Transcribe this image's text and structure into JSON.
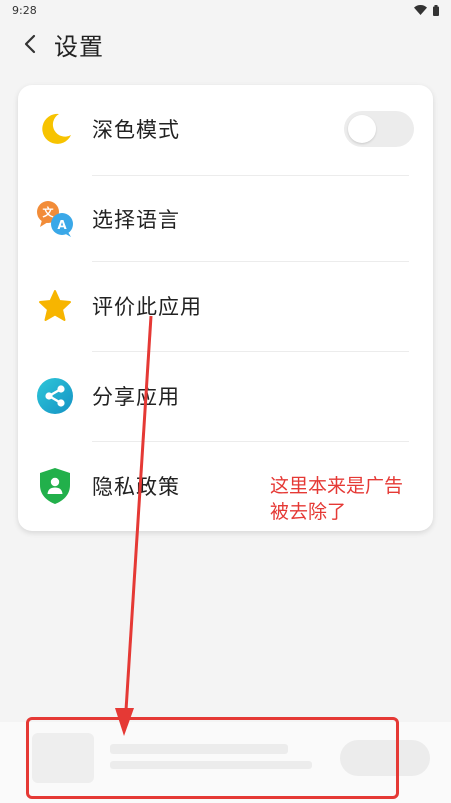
{
  "status_bar": {
    "time": "9:28"
  },
  "header": {
    "title": "设置",
    "back_icon": "chevron-left-icon"
  },
  "settings": {
    "items": [
      {
        "label": "深色模式",
        "icon": "moon-icon",
        "control": "toggle",
        "toggle_on": false
      },
      {
        "label": "选择语言",
        "icon": "translate-icon"
      },
      {
        "label": "评价此应用",
        "icon": "star-icon"
      },
      {
        "label": "分享应用",
        "icon": "share-icon"
      },
      {
        "label": "隐私政策",
        "icon": "shield-user-icon"
      }
    ]
  },
  "annotation": {
    "line1": "这里本来是广告",
    "line2": "被去除了"
  },
  "colors": {
    "background": "#f4f4f4",
    "card": "#ffffff",
    "moon": "#f7c300",
    "star": "#f7b500",
    "share": "#1ab0c9",
    "shield": "#22b04b",
    "annotation": "#e53935"
  }
}
